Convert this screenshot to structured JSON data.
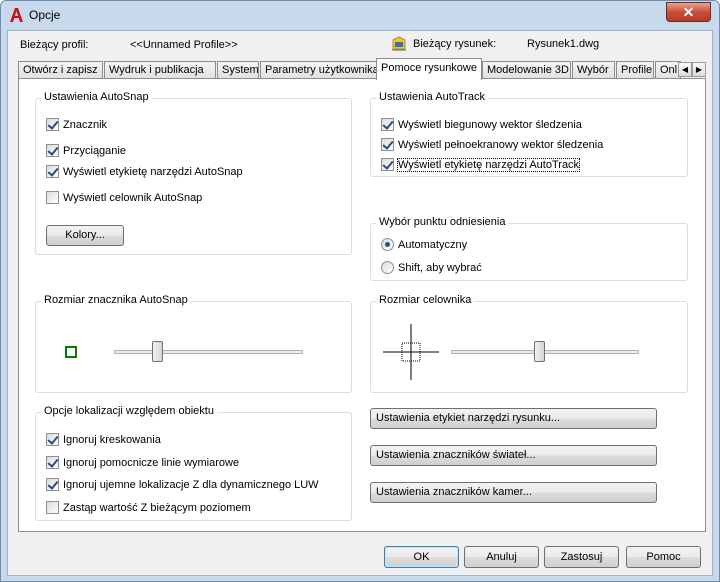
{
  "window": {
    "title": "Opcje",
    "close_glyph": "✕"
  },
  "profile": {
    "label": "Bieżący profil:",
    "value": "<<Unnamed Profile>>"
  },
  "drawing": {
    "label": "Bieżący rysunek:",
    "value": "Rysunek1.dwg",
    "icon": "drawing-file-icon"
  },
  "tabs": [
    {
      "label": "Otwórz i zapisz"
    },
    {
      "label": "Wydruk i publikacja"
    },
    {
      "label": "System"
    },
    {
      "label": "Parametry użytkownika"
    },
    {
      "label": "Pomoce rysunkowe"
    },
    {
      "label": "Modelowanie 3D"
    },
    {
      "label": "Wybór"
    },
    {
      "label": "Profile"
    },
    {
      "label": "Onl"
    }
  ],
  "tab_scroll": {
    "left": "◀",
    "right": "▶"
  },
  "autosnap": {
    "title": "Ustawienia AutoSnap",
    "items": [
      {
        "label": "Znacznik",
        "checked": true
      },
      {
        "label": "Przyciąganie",
        "checked": true
      },
      {
        "label": "Wyświetl etykietę narzędzi AutoSnap",
        "checked": true
      },
      {
        "label": "Wyświetl celownik AutoSnap",
        "checked": false
      }
    ],
    "colors_button": "Kolory..."
  },
  "autotrack": {
    "title": "Ustawienia AutoTrack",
    "items": [
      {
        "label": "Wyświetl biegunowy wektor śledzenia",
        "checked": true
      },
      {
        "label": "Wyświetl pełnoekranowy wektor śledzenia",
        "checked": true
      },
      {
        "label": "Wyświetl etykietę narzędzi AutoTrack",
        "checked": true
      }
    ]
  },
  "acquire": {
    "title": "Wybór punktu odniesienia",
    "options": [
      {
        "label": "Automatyczny",
        "selected": true
      },
      {
        "label": "Shift, aby wybrać",
        "selected": false
      }
    ]
  },
  "marker_size": {
    "title": "Rozmiar znacznika AutoSnap",
    "value": 0.23,
    "color": "#008000"
  },
  "aperture_size": {
    "title": "Rozmiar celownika",
    "value": 0.47
  },
  "object_snap": {
    "title": "Opcje lokalizacji względem obiektu",
    "items": [
      {
        "label": "Ignoruj kreskowania",
        "checked": true
      },
      {
        "label": "Ignoruj pomocnicze linie wymiarowe",
        "checked": true
      },
      {
        "label": "Ignoruj ujemne lokalizacje Z dla dynamicznego LUW",
        "checked": true
      },
      {
        "label": "Zastąp wartość Z bieżącym poziomem",
        "checked": false
      }
    ]
  },
  "settings_buttons": [
    {
      "label": "Ustawienia etykiet narzędzi rysunku..."
    },
    {
      "label": "Ustawienia znaczników świateł..."
    },
    {
      "label": "Ustawienia znaczników kamer..."
    }
  ],
  "footer": {
    "ok": "OK",
    "cancel": "Anuluj",
    "apply": "Zastosuj",
    "help": "Pomoc"
  },
  "colors": {
    "accent": "#3c7fb1",
    "title_bg": "#c9d9ec",
    "close": "#c7503a",
    "app_icon": "#d01010"
  }
}
